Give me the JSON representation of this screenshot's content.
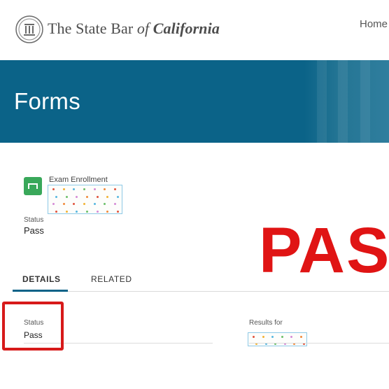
{
  "header": {
    "brand_prefix": "The State Bar ",
    "brand_of": "of",
    "brand_state": "California",
    "nav_home": "Home",
    "seal_icon": "state-bar-seal-icon"
  },
  "banner": {
    "title": "Forms",
    "color": "#0b6388"
  },
  "record": {
    "icon": "form-icon",
    "icon_color": "#39a85a",
    "type_label": "Exam Enrollment",
    "status_label": "Status",
    "status_value": "Pass"
  },
  "stamp": {
    "text": "PASS",
    "color": "#e01414"
  },
  "tabs": [
    {
      "label": "DETAILS",
      "active": true
    },
    {
      "label": "RELATED",
      "active": false
    }
  ],
  "details": {
    "status_label": "Status",
    "status_value": "Pass",
    "results_label": "Results for"
  },
  "highlight_color": "#d71a1a"
}
